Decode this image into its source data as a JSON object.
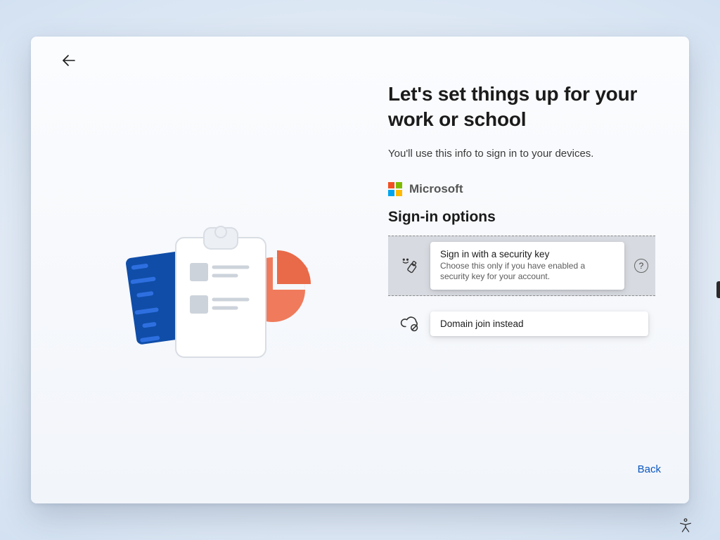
{
  "page": {
    "title": "Let's set things up for your work or school",
    "subtitle": "You'll use this info to sign in to your devices."
  },
  "brand": {
    "name": "Microsoft"
  },
  "signin": {
    "heading": "Sign-in options",
    "options": [
      {
        "title": "Sign in with a security key",
        "description": "Choose this only if you have enabled a security key for your account.",
        "selected": true,
        "help_tooltip": "?"
      },
      {
        "title": "Domain join instead",
        "description": "",
        "selected": false
      }
    ]
  },
  "actions": {
    "back_link": "Back"
  }
}
